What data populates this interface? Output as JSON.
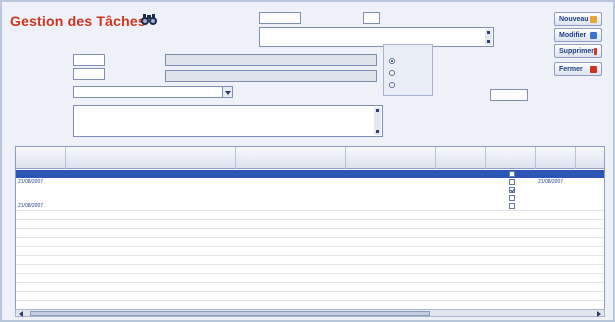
{
  "window": {
    "title": "Gestion des Tâches"
  },
  "header": {
    "date_label": "",
    "date_value": "",
    "secondary_label": "",
    "secondary_value": "",
    "objet_label": "",
    "objet_value": ""
  },
  "form": {
    "code_label": "",
    "code_value": "",
    "code_sub_label": "",
    "code_sub_value": "",
    "client_name": "",
    "client_sub": "",
    "responsable_label": "",
    "responsable_value": "",
    "compte_rendu_label": "",
    "compte_rendu_value": "",
    "statut_label": "",
    "statut_options": [
      "",
      "",
      ""
    ],
    "statut_selected": 0,
    "date_label": "",
    "date_value": ""
  },
  "buttons": {
    "nouveau": "Nouveau",
    "modifier": "Modifier",
    "supprimer": "Supprimer",
    "fermer": "Fermer"
  },
  "colors": {
    "nouveau_icon": "#e8a23a",
    "modifier_icon": "#3a74d0",
    "supprimer_icon": "#d0331e",
    "fermer_icon": "#d0331e",
    "title": "#d0331e",
    "selected_row": "#2b55b7"
  },
  "icons": {
    "title_icon": "binoculars-icon"
  },
  "table": {
    "columns": [
      "",
      "",
      "",
      "",
      "",
      "",
      "",
      ""
    ],
    "rows": [
      {
        "date": "",
        "objet": "",
        "client": "",
        "responsable": "",
        "tel": "",
        "done": false,
        "date2": "",
        "extra": "",
        "selected": true
      },
      {
        "date": "21/08/2007",
        "objet": "",
        "client": "",
        "responsable": "",
        "tel": "",
        "done": false,
        "date2": "21/08/2007",
        "extra": "",
        "selected": false
      },
      {
        "date": "",
        "objet": "",
        "client": "",
        "responsable": "",
        "tel": "",
        "done": true,
        "date2": "",
        "extra": "",
        "selected": false
      },
      {
        "date": "",
        "objet": "",
        "client": "",
        "responsable": "",
        "tel": "",
        "done": false,
        "date2": "",
        "extra": "",
        "selected": false
      },
      {
        "date": "21/08/2007",
        "objet": "",
        "client": "",
        "responsable": "",
        "tel": "",
        "done": false,
        "date2": "",
        "extra": "",
        "selected": false
      }
    ]
  }
}
